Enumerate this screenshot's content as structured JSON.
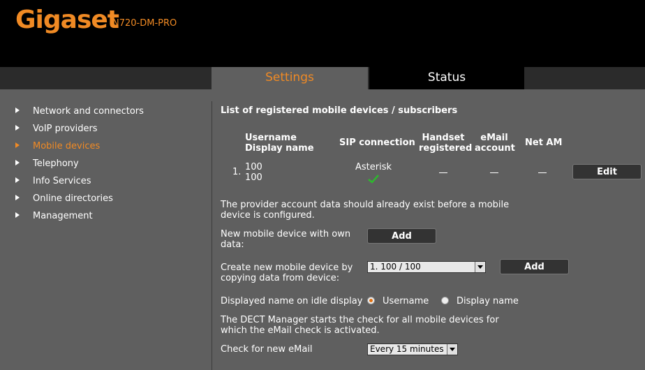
{
  "header": {
    "logo": "Gigaset",
    "model": "N720-DM-PRO"
  },
  "tabs": {
    "settings": "Settings",
    "status": "Status"
  },
  "sidebar": {
    "items": [
      {
        "label": "Network and connectors"
      },
      {
        "label": "VoIP providers"
      },
      {
        "label": "Mobile devices"
      },
      {
        "label": "Telephony"
      },
      {
        "label": "Info Services"
      },
      {
        "label": "Online directories"
      },
      {
        "label": "Management"
      }
    ]
  },
  "main": {
    "title": "List of registered mobile devices / subscribers",
    "columns": {
      "username": "Username",
      "display_name": "Display name",
      "sip": "SIP connection",
      "handset_1": "Handset",
      "handset_2": "registered",
      "email_1": "eMail",
      "email_2": "account",
      "net_am": "Net AM"
    },
    "row": {
      "index": "1.",
      "username": "100",
      "display_name": "100",
      "sip_provider": "Asterisk",
      "edit_label": "Edit"
    },
    "info_account": "The provider account data should already exist before a mobile device is configured.",
    "new_device_label": "New mobile device with own data:",
    "add_label": "Add",
    "copy_label": "Create new mobile device by copying data from device:",
    "copy_select_value": "1. 100 / 100",
    "copy_add_label": "Add",
    "idle_display_label": "Displayed name on idle display",
    "radio_username": "Username",
    "radio_display_name": "Display name",
    "info_email": "The DECT Manager starts the check for all mobile devices for which the eMail check is activated.",
    "email_check_label": "Check for new eMail",
    "email_check_value": "Every 15 minutes"
  },
  "colors": {
    "accent": "#f08a24",
    "background": "#5f5f5f",
    "check": "#2eb82e"
  }
}
